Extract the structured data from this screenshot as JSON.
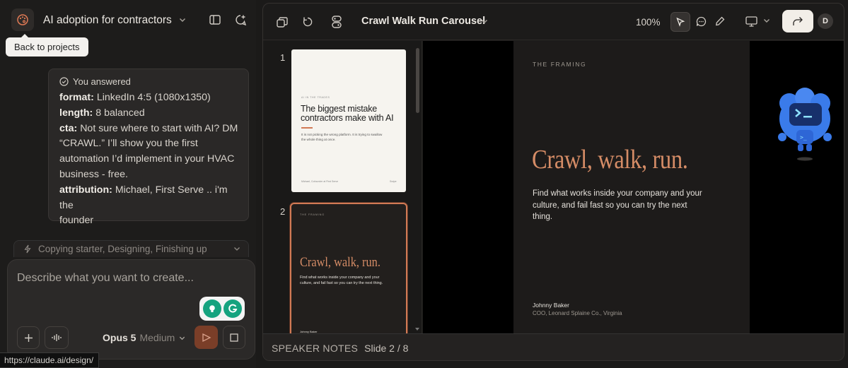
{
  "project": {
    "title": "AI adoption for contractors",
    "tooltip": "Back to projects"
  },
  "answer_card": {
    "heading": "You answered",
    "lines": [
      {
        "key": "format:",
        "value": "LinkedIn 4:5 (1080x1350)"
      },
      {
        "key": "length:",
        "value": "8 balanced"
      },
      {
        "key": "cta:",
        "value": "Not sure where to start with AI? DM"
      },
      {
        "key": "",
        "value": "“CRAWL.” I’ll show you the first"
      },
      {
        "key": "",
        "value": "automation I’d implement in your HVAC"
      },
      {
        "key": "",
        "value": "business - free."
      },
      {
        "key": "attribution:",
        "value": "Michael, First Serve .. i'm the"
      },
      {
        "key": "",
        "value": "founder"
      }
    ]
  },
  "progress": {
    "text": "Copying starter, Designing, Finishing up"
  },
  "composer": {
    "placeholder": "Describe what you want to create...",
    "model": "Opus 5",
    "effort": "Medium"
  },
  "status_url": "https://claude.ai/design/",
  "editor": {
    "doc_title": "Crawl Walk Run Carousel",
    "zoom": "100%",
    "avatar_initial": "D"
  },
  "thumbnails": [
    {
      "number": "1",
      "eyebrow": "AI IN THE TRADES",
      "title": "The biggest mistake contractors make with AI",
      "body": "It is not picking the wrong platform. It is trying to swallow the whole thing at once.",
      "footer_left": "Michael, Cofounder at First Serve",
      "footer_right": "Swipe"
    },
    {
      "number": "2",
      "eyebrow": "THE FRAMING",
      "title": "Crawl, walk, run.",
      "body": "Find what works inside your company and your culture, and fail fast so you can try the next thing.",
      "name": "Johnny Baker"
    }
  ],
  "slide": {
    "eyebrow": "THE FRAMING",
    "title": "Crawl, walk, run.",
    "body": "Find what works inside your company and your culture, and fail fast so you can try the next thing.",
    "name": "Johnny Baker",
    "role": "COO, Leonard Splaine Co., Virginia"
  },
  "notes": {
    "label": "SPEAKER NOTES",
    "counter": "Slide 2 / 8"
  },
  "colors": {
    "accent": "#d58c66",
    "send": "#7a3e28",
    "panel": "#1d1c1b",
    "slide_bg": "#1d1b1a"
  }
}
